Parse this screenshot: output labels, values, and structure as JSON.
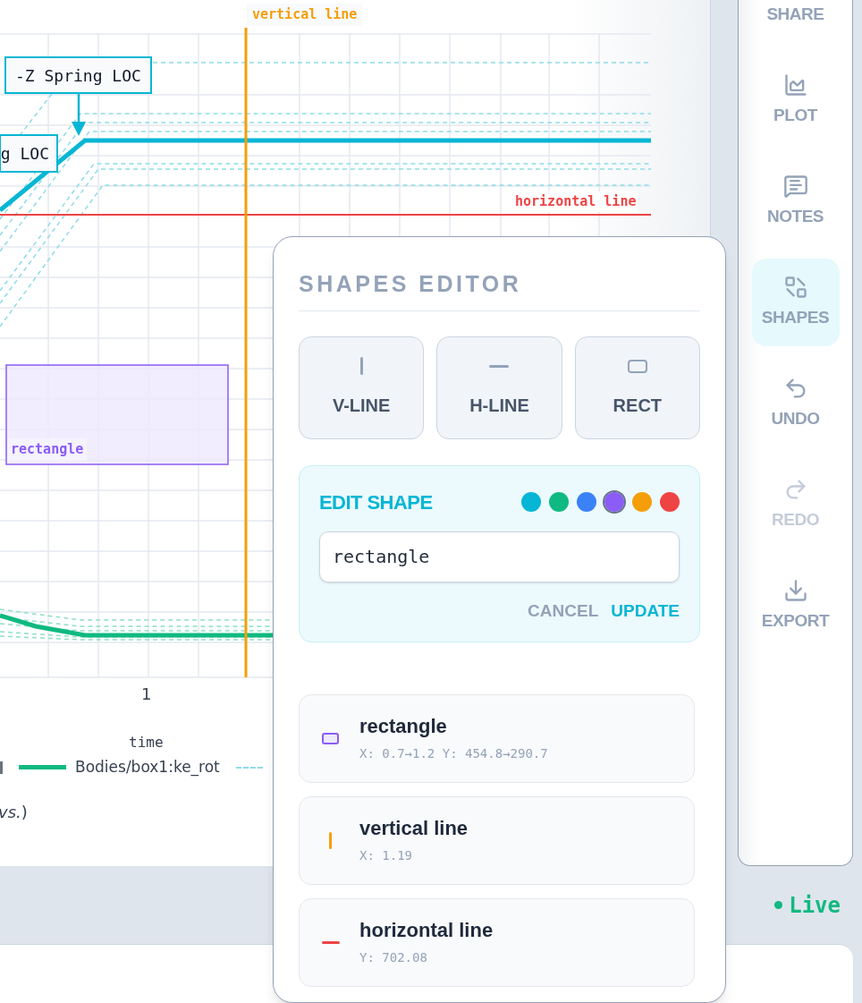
{
  "plot": {
    "callouts": [
      {
        "kind": "full",
        "text": "-Z Spring LOC"
      },
      {
        "kind": "cut",
        "text": "g LOC"
      }
    ],
    "overlays": [
      {
        "kind": "vline",
        "label": "vertical line",
        "color": "#f59e0b"
      },
      {
        "kind": "hline",
        "label": "horizontal line",
        "color": "#ef4444"
      },
      {
        "kind": "rect",
        "label": "rectangle",
        "color": "#8b5cf6"
      }
    ],
    "x_tick": "1",
    "xlabel": "time",
    "legend": [
      {
        "label": "Bodies/box1:ke_rot",
        "color": "#10b981"
      }
    ],
    "note": "*vs.*)"
  },
  "sidebar": {
    "items": [
      {
        "kind": "share",
        "label": "SHARE",
        "selected": false,
        "disabled": false
      },
      {
        "kind": "plot",
        "label": "PLOT",
        "selected": false,
        "disabled": false
      },
      {
        "kind": "notes",
        "label": "NOTES",
        "selected": false,
        "disabled": false
      },
      {
        "kind": "shapes",
        "label": "SHAPES",
        "selected": true,
        "disabled": false
      },
      {
        "kind": "undo",
        "label": "UNDO",
        "selected": false,
        "disabled": false
      },
      {
        "kind": "redo",
        "label": "REDO",
        "selected": false,
        "disabled": true
      },
      {
        "kind": "export",
        "label": "EXPORT",
        "selected": false,
        "disabled": false
      }
    ]
  },
  "status": {
    "label": "Live",
    "on": true
  },
  "shapes_editor": {
    "title": "SHAPES EDITOR",
    "add_buttons": [
      {
        "kind": "vline",
        "label": "V-LINE"
      },
      {
        "kind": "hline",
        "label": "H-LINE"
      },
      {
        "kind": "rect",
        "label": "RECT"
      }
    ],
    "edit": {
      "title": "EDIT SHAPE",
      "colors": [
        {
          "color": "#06b6d4",
          "selected": false
        },
        {
          "color": "#10b981",
          "selected": false
        },
        {
          "color": "#3b82f6",
          "selected": false
        },
        {
          "color": "#8b5cf6",
          "selected": true
        },
        {
          "color": "#f59e0b",
          "selected": false
        },
        {
          "color": "#ef4444",
          "selected": false
        }
      ],
      "value": "rectangle",
      "cancel": "CANCEL",
      "update": "UPDATE"
    },
    "shapes": [
      {
        "kind": "rect",
        "name": "rectangle",
        "coords": "X: 0.7→1.2 Y: 454.8→290.7",
        "color": "#8b5cf6"
      },
      {
        "kind": "vline",
        "name": "vertical line",
        "coords": "X: 1.19",
        "color": "#f59e0b"
      },
      {
        "kind": "hline",
        "name": "horizontal line",
        "coords": "Y: 702.08",
        "color": "#ef4444"
      }
    ]
  }
}
